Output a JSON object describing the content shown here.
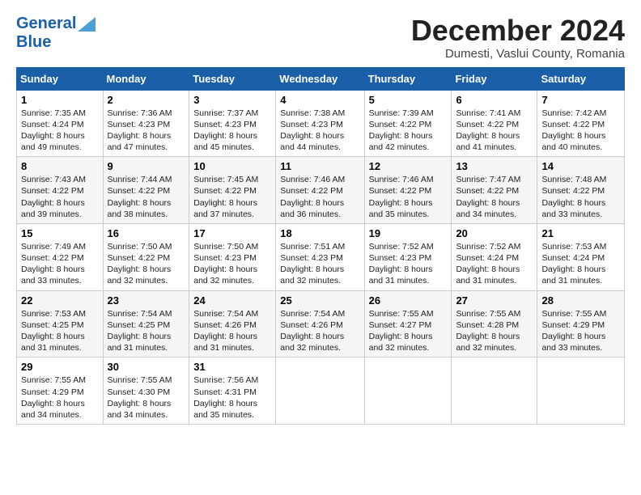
{
  "header": {
    "logo_line1": "General",
    "logo_line2": "Blue",
    "month_title": "December 2024",
    "subtitle": "Dumesti, Vaslui County, Romania"
  },
  "calendar": {
    "headers": [
      "Sunday",
      "Monday",
      "Tuesday",
      "Wednesday",
      "Thursday",
      "Friday",
      "Saturday"
    ],
    "weeks": [
      [
        {
          "day": "1",
          "sunrise": "7:35 AM",
          "sunset": "4:24 PM",
          "daylight": "8 hours and 49 minutes."
        },
        {
          "day": "2",
          "sunrise": "7:36 AM",
          "sunset": "4:23 PM",
          "daylight": "8 hours and 47 minutes."
        },
        {
          "day": "3",
          "sunrise": "7:37 AM",
          "sunset": "4:23 PM",
          "daylight": "8 hours and 45 minutes."
        },
        {
          "day": "4",
          "sunrise": "7:38 AM",
          "sunset": "4:23 PM",
          "daylight": "8 hours and 44 minutes."
        },
        {
          "day": "5",
          "sunrise": "7:39 AM",
          "sunset": "4:22 PM",
          "daylight": "8 hours and 42 minutes."
        },
        {
          "day": "6",
          "sunrise": "7:41 AM",
          "sunset": "4:22 PM",
          "daylight": "8 hours and 41 minutes."
        },
        {
          "day": "7",
          "sunrise": "7:42 AM",
          "sunset": "4:22 PM",
          "daylight": "8 hours and 40 minutes."
        }
      ],
      [
        {
          "day": "8",
          "sunrise": "7:43 AM",
          "sunset": "4:22 PM",
          "daylight": "8 hours and 39 minutes."
        },
        {
          "day": "9",
          "sunrise": "7:44 AM",
          "sunset": "4:22 PM",
          "daylight": "8 hours and 38 minutes."
        },
        {
          "day": "10",
          "sunrise": "7:45 AM",
          "sunset": "4:22 PM",
          "daylight": "8 hours and 37 minutes."
        },
        {
          "day": "11",
          "sunrise": "7:46 AM",
          "sunset": "4:22 PM",
          "daylight": "8 hours and 36 minutes."
        },
        {
          "day": "12",
          "sunrise": "7:46 AM",
          "sunset": "4:22 PM",
          "daylight": "8 hours and 35 minutes."
        },
        {
          "day": "13",
          "sunrise": "7:47 AM",
          "sunset": "4:22 PM",
          "daylight": "8 hours and 34 minutes."
        },
        {
          "day": "14",
          "sunrise": "7:48 AM",
          "sunset": "4:22 PM",
          "daylight": "8 hours and 33 minutes."
        }
      ],
      [
        {
          "day": "15",
          "sunrise": "7:49 AM",
          "sunset": "4:22 PM",
          "daylight": "8 hours and 33 minutes."
        },
        {
          "day": "16",
          "sunrise": "7:50 AM",
          "sunset": "4:22 PM",
          "daylight": "8 hours and 32 minutes."
        },
        {
          "day": "17",
          "sunrise": "7:50 AM",
          "sunset": "4:23 PM",
          "daylight": "8 hours and 32 minutes."
        },
        {
          "day": "18",
          "sunrise": "7:51 AM",
          "sunset": "4:23 PM",
          "daylight": "8 hours and 32 minutes."
        },
        {
          "day": "19",
          "sunrise": "7:52 AM",
          "sunset": "4:23 PM",
          "daylight": "8 hours and 31 minutes."
        },
        {
          "day": "20",
          "sunrise": "7:52 AM",
          "sunset": "4:24 PM",
          "daylight": "8 hours and 31 minutes."
        },
        {
          "day": "21",
          "sunrise": "7:53 AM",
          "sunset": "4:24 PM",
          "daylight": "8 hours and 31 minutes."
        }
      ],
      [
        {
          "day": "22",
          "sunrise": "7:53 AM",
          "sunset": "4:25 PM",
          "daylight": "8 hours and 31 minutes."
        },
        {
          "day": "23",
          "sunrise": "7:54 AM",
          "sunset": "4:25 PM",
          "daylight": "8 hours and 31 minutes."
        },
        {
          "day": "24",
          "sunrise": "7:54 AM",
          "sunset": "4:26 PM",
          "daylight": "8 hours and 31 minutes."
        },
        {
          "day": "25",
          "sunrise": "7:54 AM",
          "sunset": "4:26 PM",
          "daylight": "8 hours and 32 minutes."
        },
        {
          "day": "26",
          "sunrise": "7:55 AM",
          "sunset": "4:27 PM",
          "daylight": "8 hours and 32 minutes."
        },
        {
          "day": "27",
          "sunrise": "7:55 AM",
          "sunset": "4:28 PM",
          "daylight": "8 hours and 32 minutes."
        },
        {
          "day": "28",
          "sunrise": "7:55 AM",
          "sunset": "4:29 PM",
          "daylight": "8 hours and 33 minutes."
        }
      ],
      [
        {
          "day": "29",
          "sunrise": "7:55 AM",
          "sunset": "4:29 PM",
          "daylight": "8 hours and 34 minutes."
        },
        {
          "day": "30",
          "sunrise": "7:55 AM",
          "sunset": "4:30 PM",
          "daylight": "8 hours and 34 minutes."
        },
        {
          "day": "31",
          "sunrise": "7:56 AM",
          "sunset": "4:31 PM",
          "daylight": "8 hours and 35 minutes."
        },
        null,
        null,
        null,
        null
      ]
    ]
  }
}
